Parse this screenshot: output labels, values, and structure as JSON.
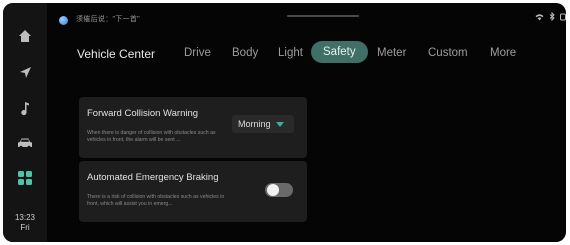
{
  "status": {
    "notification": "须催后说：\"下一首\"",
    "icons": [
      "wifi-icon",
      "bluetooth-icon",
      "signal-icon"
    ]
  },
  "rail": {
    "items": [
      "home-icon",
      "navigation-icon",
      "music-icon",
      "car-icon",
      "apps-icon"
    ],
    "clock_time": "13:23",
    "clock_day": "Fri"
  },
  "header": {
    "title": "Vehicle Center",
    "tabs": [
      {
        "label": "Drive"
      },
      {
        "label": "Body"
      },
      {
        "label": "Light"
      },
      {
        "label": "Safety"
      },
      {
        "label": "Meter"
      },
      {
        "label": "Custom"
      },
      {
        "label": "More"
      }
    ],
    "active_tab": "Safety"
  },
  "settings": {
    "fcw": {
      "title": "Forward Collision Warning",
      "description": "When there is danger of collision with obstacles such as vehicles in front, the alarm will be sent ...",
      "value": "Morning"
    },
    "aeb": {
      "title": "Automated Emergency Braking",
      "description": "There is a risk of collision with obstacles such as vehicles in front, which will assist you in emerg...",
      "enabled": false
    }
  },
  "colors": {
    "accent": "#3f6f66",
    "caret": "#3fae98",
    "background": "#050505",
    "card": "#1e1e1e"
  }
}
